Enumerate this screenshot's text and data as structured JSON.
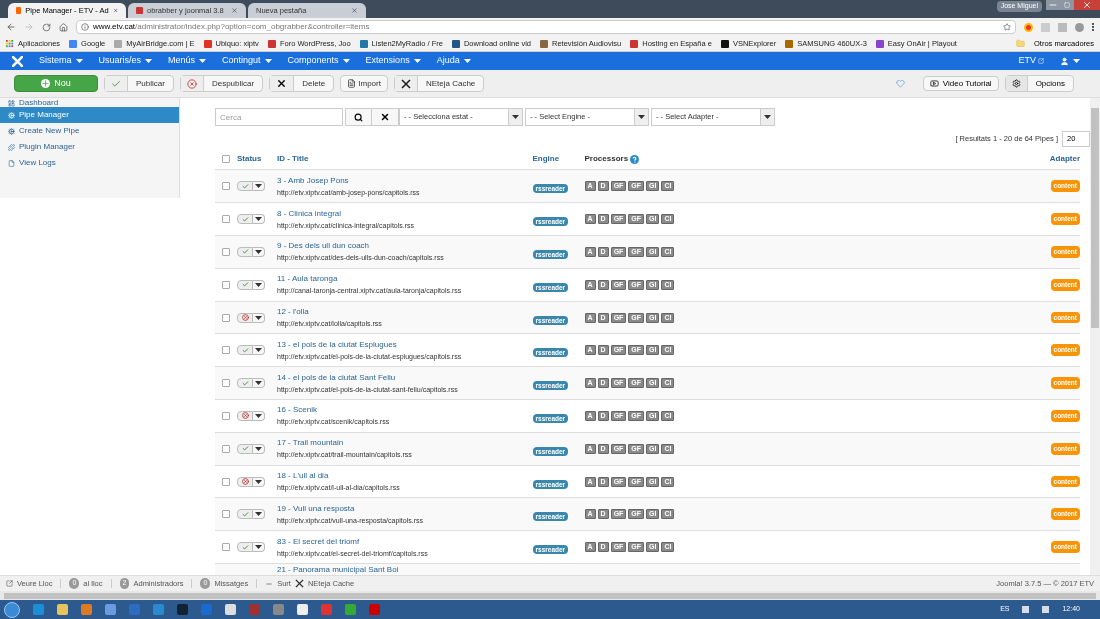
{
  "browser": {
    "tabs": [
      {
        "title": "Pipe Manager - ETV - Ad",
        "selected": true
      },
      {
        "title": "obrabber y joonmal 3.8",
        "selected": false
      },
      {
        "title": "Nueva pestaña",
        "selected": false
      }
    ],
    "user": "Jose Miguel",
    "url_host": "www.etv.cat",
    "url_path": "/administrator/index.php?option=com_obgrabber&controller=items",
    "bookmarks": [
      "Aplicaciones",
      "Google",
      "MyAirBridge.com | E",
      "Ubiquo: xiptv",
      "Foro WordPress, Joo",
      "Listen2MyRadio / Fre",
      "Download online vid",
      "Retevisión Audiovisu",
      "Hosting en España e",
      "VSNExplorer",
      "SAMSUNG 460UX-3",
      "Easy OnAir | Playout"
    ],
    "other_bookmarks": "Otros marcadores"
  },
  "nav": {
    "menus": [
      "Sistema",
      "Usuaris/es",
      "Menús",
      "Contingut",
      "Components",
      "Extensions",
      "Ajuda"
    ],
    "site": "ETV"
  },
  "toolbar": {
    "buttons": [
      {
        "kind": "new",
        "label": "Nou"
      },
      {
        "kind": "publish",
        "label": "Publicar"
      },
      {
        "kind": "unpublish",
        "label": "Despublicar"
      },
      {
        "kind": "delete",
        "label": "Delete"
      },
      {
        "kind": "import",
        "label": "Import"
      },
      {
        "kind": "cache",
        "label": "NEteja Cache"
      }
    ],
    "video": "Video Tutorial",
    "options": "Opcions"
  },
  "sidebar": {
    "items": [
      {
        "label": "Dashboard",
        "selected": false
      },
      {
        "label": "Pipe Manager",
        "selected": true
      },
      {
        "label": "Create New Pipe",
        "selected": false
      },
      {
        "label": "Plugin Manager",
        "selected": false
      },
      {
        "label": "View Logs",
        "selected": false
      }
    ]
  },
  "filters": {
    "search_placeholder": "Cerca",
    "selects": [
      "- - Selecciona estat -",
      "- - Select Engine -",
      "- - Select Adapter -"
    ]
  },
  "results": "[ Resultats 1 - 20 de 64 Pipes ]",
  "limit": "20",
  "table": {
    "select_all_checked": false,
    "columns": [
      "Status",
      "ID - Title",
      "Engine",
      "Processors",
      "Adapter"
    ],
    "rows": [
      {
        "checked": false,
        "published": true,
        "title": "3 - Amb Josep Pons",
        "url": "http://etv.xiptv.cat/amb-josep-pons/capitols.rss",
        "engine": "rssreader",
        "processors": [
          "A",
          "D",
          "GF",
          "GF",
          "GI",
          "CI"
        ],
        "adapter": "content"
      },
      {
        "checked": false,
        "published": true,
        "title": "8 - Clinica integral",
        "url": "http://etv.xiptv.cat/clinica-integral/capitols.rss",
        "engine": "rssreader",
        "processors": [
          "A",
          "D",
          "GF",
          "GF",
          "GI",
          "CI"
        ],
        "adapter": "content"
      },
      {
        "checked": false,
        "published": true,
        "title": "9 - Des dels ull dun coach",
        "url": "http://etv.xiptv.cat/des-dels-ulls-dun-coach/capitols.rss",
        "engine": "rssreader",
        "processors": [
          "A",
          "D",
          "GF",
          "GF",
          "GI",
          "CI"
        ],
        "adapter": "content"
      },
      {
        "checked": false,
        "published": true,
        "title": "11 - Aula taronga",
        "url": "http://canal-taronja-central.xiptv.cat/aula-taronja/capitols.rss",
        "engine": "rssreader",
        "processors": [
          "A",
          "D",
          "GF",
          "GF",
          "GI",
          "CI"
        ],
        "adapter": "content"
      },
      {
        "checked": false,
        "published": false,
        "title": "12 - l'olla",
        "url": "http://etv.xiptv.cat/lolla/capitols.rss",
        "engine": "rssreader",
        "processors": [
          "A",
          "D",
          "GF",
          "GF",
          "GI",
          "CI"
        ],
        "adapter": "content"
      },
      {
        "checked": false,
        "published": true,
        "title": "13 - el pols de la ciutat Esplugues",
        "url": "http://etv.xiptv.cat/el-pols-de-la-ciutat-esplugues/capitols.rss",
        "engine": "rssreader",
        "processors": [
          "A",
          "D",
          "GF",
          "GF",
          "GI",
          "CI"
        ],
        "adapter": "content"
      },
      {
        "checked": false,
        "published": true,
        "title": "14 - el pols de la ciutat Sant Feliu",
        "url": "http://etv.xiptv.cat/el-pols-de-la-ciutat-sant-feliu/capitols.rss",
        "engine": "rssreader",
        "processors": [
          "A",
          "D",
          "GF",
          "GF",
          "GI",
          "CI"
        ],
        "adapter": "content"
      },
      {
        "checked": false,
        "published": false,
        "title": "16 - Scenik",
        "url": "http://etv.xiptv.cat/scenik/capitols.rss",
        "engine": "rssreader",
        "processors": [
          "A",
          "D",
          "GF",
          "GF",
          "GI",
          "CI"
        ],
        "adapter": "content"
      },
      {
        "checked": false,
        "published": true,
        "title": "17 - Trail mountain",
        "url": "http://etv.xiptv.cat/trail-mountain/capitols.rss",
        "engine": "rssreader",
        "processors": [
          "A",
          "D",
          "GF",
          "GF",
          "GI",
          "CI"
        ],
        "adapter": "content"
      },
      {
        "checked": false,
        "published": false,
        "title": "18 - L'ull al dia",
        "url": "http://etv.xiptv.cat/l-ull-al-dia/capitols.rss",
        "engine": "rssreader",
        "processors": [
          "A",
          "D",
          "GF",
          "GF",
          "GI",
          "CI"
        ],
        "adapter": "content"
      },
      {
        "checked": false,
        "published": true,
        "title": "19 - Vull una resposta",
        "url": "http://etv.xiptv.cat/vull-una-resposta/capitols.rss",
        "engine": "rssreader",
        "processors": [
          "A",
          "D",
          "GF",
          "GF",
          "GI",
          "CI"
        ],
        "adapter": "content"
      },
      {
        "checked": false,
        "published": true,
        "title": "83 - El secret del triomf",
        "url": "http://etv.xiptv.cat/el-secret-del-triomf/capitols.rss",
        "engine": "rssreader",
        "processors": [
          "A",
          "D",
          "GF",
          "GF",
          "GI",
          "CI"
        ],
        "adapter": "content"
      },
      {
        "title": "21 - Panorama municipal Sant Boi"
      }
    ]
  },
  "status_bar": {
    "view_site": "Veure Lloc",
    "visitors_count": "0",
    "visitors": "al lloc",
    "admins_count": "2",
    "admins": "Administradors",
    "messages_count": "0",
    "messages": "Missatges",
    "logout": "Surt",
    "cache": "NEteja Cache",
    "version": "Joomla! 3.7.5 — © 2017 ETV"
  },
  "taskbar": {
    "language": "ES",
    "time": "12:40"
  }
}
